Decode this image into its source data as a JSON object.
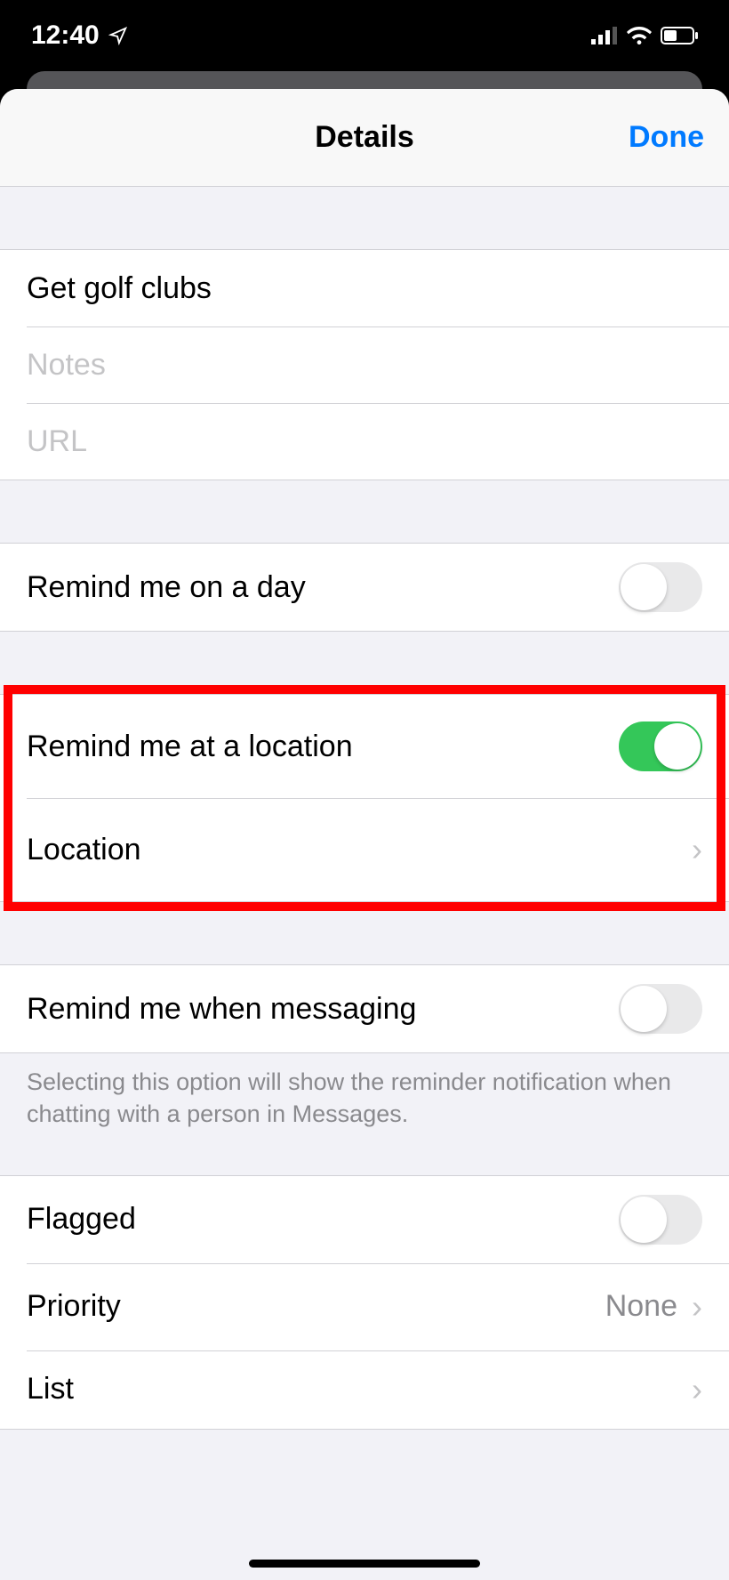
{
  "statusBar": {
    "time": "12:40"
  },
  "nav": {
    "title": "Details",
    "done": "Done"
  },
  "fields": {
    "title": "Get golf clubs",
    "notesPlaceholder": "Notes",
    "urlPlaceholder": "URL"
  },
  "rows": {
    "remindDay": "Remind me on a day",
    "remindLocation": "Remind me at a location",
    "location": "Location",
    "remindMessaging": "Remind me when messaging",
    "messagingFooter": "Selecting this option will show the reminder notification when chatting with a person in Messages.",
    "flagged": "Flagged",
    "priority": "Priority",
    "priorityValue": "None",
    "list": "List"
  }
}
